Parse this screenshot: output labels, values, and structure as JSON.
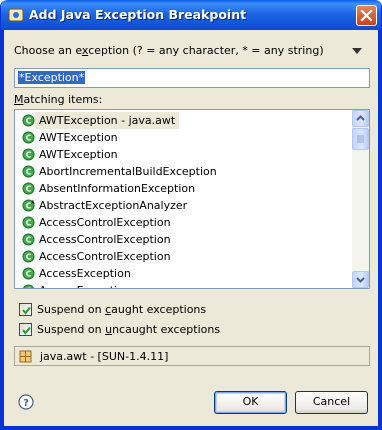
{
  "window": {
    "title": "Add Java Exception Breakpoint",
    "title_icon": "debug-breakpoint-icon",
    "close_icon": "close-icon"
  },
  "filter": {
    "label_pre": "Choose an e",
    "label_mnemonic": "x",
    "label_post": "ception (? = any character, * = any string)",
    "value": "*Exception*",
    "menu_icon": "dropdown-arrow-icon"
  },
  "matching": {
    "label_mnemonic": "M",
    "label_post": "atching items:",
    "items": [
      {
        "label": "AWTException - java.awt",
        "selected": true
      },
      {
        "label": "AWTException"
      },
      {
        "label": "AWTException"
      },
      {
        "label": "AbortIncrementalBuildException"
      },
      {
        "label": "AbsentInformationException"
      },
      {
        "label": "AbstractExceptionAnalyzer",
        "abstract": true
      },
      {
        "label": "AccessControlException"
      },
      {
        "label": "AccessControlException"
      },
      {
        "label": "AccessControlException"
      },
      {
        "label": "AccessException"
      },
      {
        "label": "AccessException"
      }
    ]
  },
  "options": {
    "caught_pre": "Suspend on ",
    "caught_mnemonic": "c",
    "caught_post": "aught exceptions",
    "caught_checked": true,
    "uncaught_pre": "Suspend on ",
    "uncaught_mnemonic": "u",
    "uncaught_post": "ncaught exceptions",
    "uncaught_checked": true
  },
  "location": {
    "text": "java.awt - [SUN-1.4.11]",
    "icon": "package-icon"
  },
  "buttons": {
    "ok": "OK",
    "cancel": "Cancel",
    "help_icon": "help-icon"
  },
  "colors": {
    "titlebar": "#0a5fe8",
    "dialog_bg": "#ece9d8",
    "selection": "#316ac5",
    "class_icon": "#2e9c3a"
  }
}
